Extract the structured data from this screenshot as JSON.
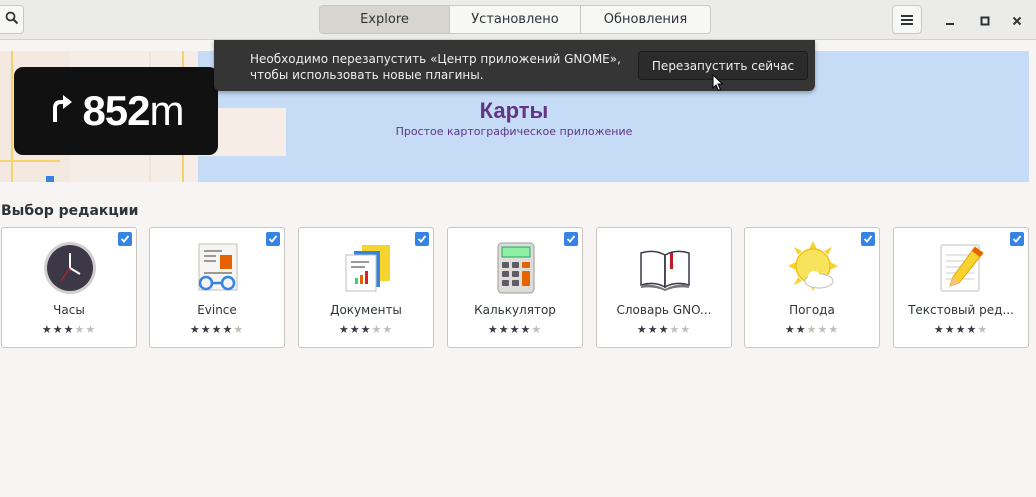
{
  "header": {
    "search_icon": "search-icon",
    "tabs": [
      {
        "label": "Explore",
        "active": true
      },
      {
        "label": "Установлено",
        "active": false
      },
      {
        "label": "Обновления",
        "active": false
      }
    ],
    "menu_icon": "hamburger-icon"
  },
  "notification": {
    "line1": "Необходимо перезапустить «Центр приложений GNOME»,",
    "line2": "чтобы использовать новые плагины.",
    "button_label": "Перезапустить сейчас"
  },
  "banner": {
    "title": "Карты",
    "subtitle": "Простое картографическое приложение",
    "nav_distance": "852",
    "nav_unit": "m",
    "nav_icon": "turn-right-arrow-icon",
    "background_color": "#c6dbf5",
    "title_color": "#613583"
  },
  "section": {
    "title": "Выбор редакции"
  },
  "apps": [
    {
      "name": "Часы",
      "icon": "clock-icon",
      "rating": 3
    },
    {
      "name": "Evince",
      "icon": "document-viewer-icon",
      "rating": 4
    },
    {
      "name": "Документы",
      "icon": "documents-icon",
      "rating": 3
    },
    {
      "name": "Калькулятор",
      "icon": "calculator-icon",
      "rating": 4
    },
    {
      "name": "Словарь GNO...",
      "icon": "dictionary-icon",
      "rating": 3
    },
    {
      "name": "Погода",
      "icon": "weather-icon",
      "rating": 2
    },
    {
      "name": "Текстовый ред...",
      "icon": "text-editor-icon",
      "rating": 4
    }
  ],
  "colors": {
    "accent": "#3584e4",
    "notification_bg": "#353535"
  }
}
